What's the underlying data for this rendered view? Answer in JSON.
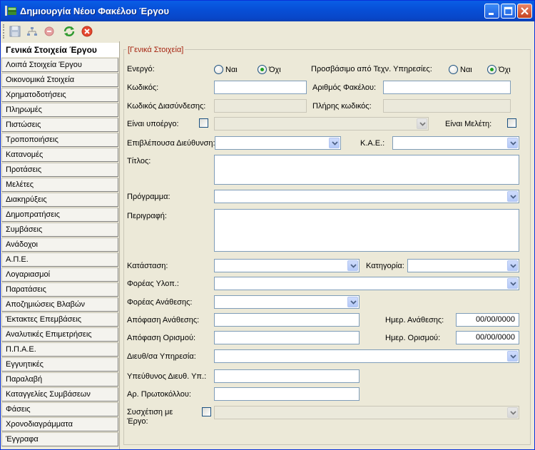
{
  "window": {
    "title": "Δημιουργία Νέου Φακέλου Έργου"
  },
  "colors": {
    "titlebar": "#0750d8",
    "legend": "#a62411",
    "radio_dot": "#21a121"
  },
  "toolbar": {
    "icons": [
      "save-icon",
      "tree-icon",
      "delete-icon",
      "refresh-icon",
      "cancel-icon"
    ]
  },
  "nav": {
    "items": [
      {
        "label": "Γενικά Στοιχεία Έργου"
      },
      {
        "label": "Λοιπά Στοιχεία Έργου"
      },
      {
        "label": "Οικονομικά Στοιχεία"
      },
      {
        "label": "Χρηματοδοτήσεις"
      },
      {
        "label": "Πληρωμές"
      },
      {
        "label": "Πιστώσεις"
      },
      {
        "label": "Τροποποιήσεις"
      },
      {
        "label": "Κατανομές"
      },
      {
        "label": "Προτάσεις"
      },
      {
        "label": "Μελέτες"
      },
      {
        "label": "Διακηρύξεις"
      },
      {
        "label": "Δημοπρατήσεις"
      },
      {
        "label": "Συμβάσεις"
      },
      {
        "label": "Ανάδοχοι"
      },
      {
        "label": "Α.Π.Ε."
      },
      {
        "label": "Λογαριασμοί"
      },
      {
        "label": "Παρατάσεις"
      },
      {
        "label": "Αποζημιώσεις Βλαβών"
      },
      {
        "label": "Έκτακτες Επεμβάσεις"
      },
      {
        "label": "Αναλυτικές Επιμετρήσεις"
      },
      {
        "label": "Π.Π.Α.Ε."
      },
      {
        "label": "Εγγυητικές"
      },
      {
        "label": "Παραλαβή"
      },
      {
        "label": "Καταγγελίες Συμβάσεων"
      },
      {
        "label": "Φάσεις"
      },
      {
        "label": "Χρονοδιαγράμματα"
      },
      {
        "label": "Έγγραφα"
      }
    ]
  },
  "form": {
    "legend": "[Γενικά Στοιχεία]",
    "active": {
      "label": "Ενεργό:",
      "yes": "Ναι",
      "no": "Όχι",
      "selected": "no"
    },
    "accessible": {
      "label": "Προσβάσιμο από Τεχν. Υπηρεσίες:",
      "yes": "Ναι",
      "no": "Όχι",
      "selected": "no"
    },
    "code": {
      "label": "Κωδικός:",
      "value": ""
    },
    "folder_number": {
      "label": "Αριθμός Φακέλου:",
      "value": ""
    },
    "link_code": {
      "label": "Κωδικός Διασύνδεσης:",
      "value": ""
    },
    "full_code": {
      "label": "Πλήρης κωδικός:",
      "value": ""
    },
    "subproject": {
      "label": "Είναι υποέργο:",
      "checked": false,
      "value": ""
    },
    "is_study": {
      "label": "Είναι Μελέτη:",
      "checked": false
    },
    "supervising": {
      "label": "Επιβλέπουσα Διεύθυνση:",
      "value": ""
    },
    "kae": {
      "label": "Κ.Α.Ε.:",
      "value": ""
    },
    "title": {
      "label": "Τίτλος:",
      "value": ""
    },
    "program": {
      "label": "Πρόγραμμα:",
      "value": ""
    },
    "description": {
      "label": "Περιγραφή:",
      "value": ""
    },
    "status": {
      "label": "Κατάσταση:",
      "value": ""
    },
    "category": {
      "label": "Κατηγορία:",
      "value": ""
    },
    "implementing_body": {
      "label": "Φορέας Υλοπ.:",
      "value": ""
    },
    "assigning_body": {
      "label": "Φορέας Ανάθεσης:",
      "value": ""
    },
    "assign_decision": {
      "label": "Απόφαση Ανάθεσης:",
      "value": ""
    },
    "assign_date": {
      "label": "Ημερ. Ανάθεσης:",
      "value": "00/00/0000"
    },
    "define_decision": {
      "label": "Απόφαση Ορισμού:",
      "value": ""
    },
    "define_date": {
      "label": "Ημερ. Ορισμού:",
      "value": "00/00/0000"
    },
    "directorate": {
      "label": "Διευθ/σα Υπηρεσία:",
      "value": ""
    },
    "responsible": {
      "label": "Υπεύθυνος Διευθ. Υπ.:",
      "value": ""
    },
    "protocol": {
      "label": "Αρ. Πρωτοκόλλου:",
      "value": ""
    },
    "relation": {
      "label_line1": "Συσχέτιση με",
      "label_line2": "Έργο:",
      "checked": false,
      "value": ""
    }
  }
}
